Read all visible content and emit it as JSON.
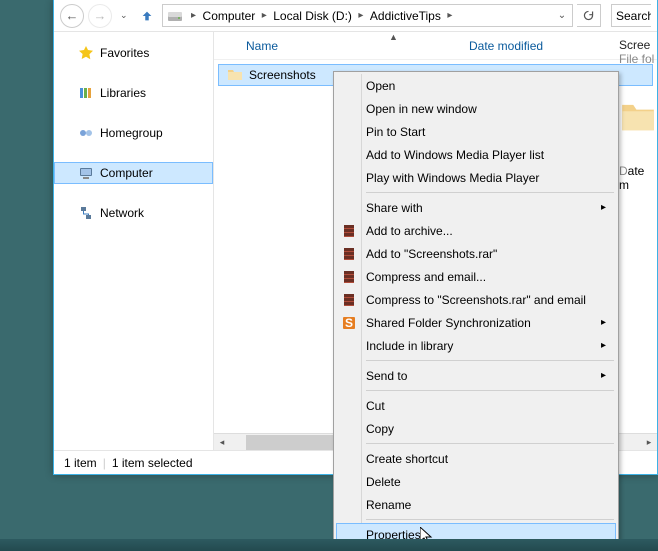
{
  "toolbar": {
    "search_placeholder": "Search"
  },
  "breadcrumbs": [
    "Computer",
    "Local Disk (D:)",
    "AddictiveTips"
  ],
  "columns": {
    "name": "Name",
    "date": "Date modified"
  },
  "nav": {
    "favorites": "Favorites",
    "libraries": "Libraries",
    "homegroup": "Homegroup",
    "computer": "Computer",
    "network": "Network"
  },
  "file": {
    "name": "Screenshots"
  },
  "status": {
    "count": "1 item",
    "selected": "1 item selected"
  },
  "preview": {
    "title": "Scree",
    "type": "File fol",
    "date_label": "ate m"
  },
  "ctx": {
    "open": "Open",
    "open_new": "Open in new window",
    "pin": "Pin to Start",
    "wmp_add": "Add to Windows Media Player list",
    "wmp_play": "Play with Windows Media Player",
    "share": "Share with",
    "archive_add": "Add to archive...",
    "archive_name": "Add to \"Screenshots.rar\"",
    "compress_email": "Compress and email...",
    "compress_name_email": "Compress to \"Screenshots.rar\" and email",
    "sfs": "Shared Folder Synchronization",
    "include": "Include in library",
    "sendto": "Send to",
    "cut": "Cut",
    "copy": "Copy",
    "shortcut": "Create shortcut",
    "delete": "Delete",
    "rename": "Rename",
    "properties": "Properties"
  }
}
